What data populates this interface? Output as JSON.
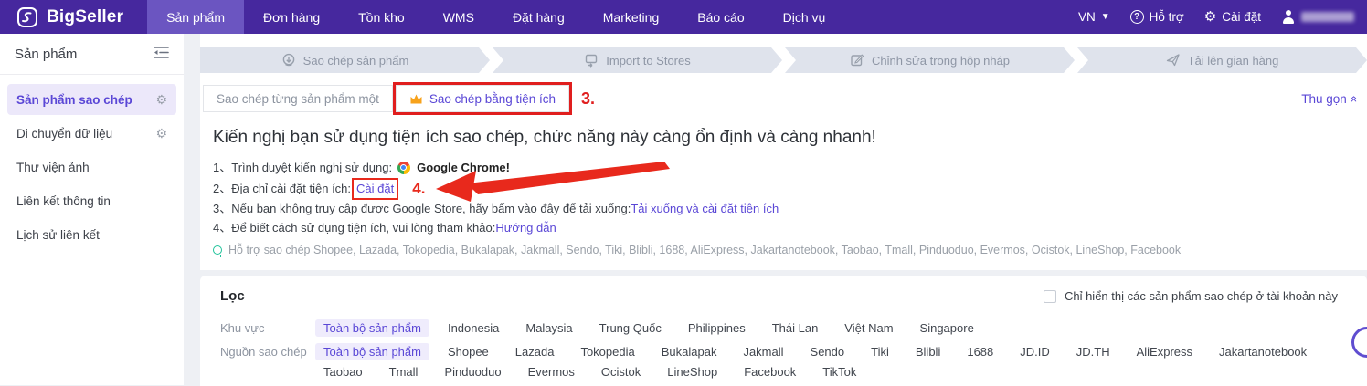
{
  "navbar": {
    "brand": "BigSeller",
    "items": [
      {
        "label": "Sản phẩm",
        "active": true
      },
      {
        "label": "Đơn hàng"
      },
      {
        "label": "Tồn kho"
      },
      {
        "label": "WMS"
      },
      {
        "label": "Đặt hàng"
      },
      {
        "label": "Marketing"
      },
      {
        "label": "Báo cáo"
      },
      {
        "label": "Dịch vụ"
      }
    ],
    "locale": "VN",
    "help_label": "Hỗ trợ",
    "settings_label": "Cài đặt"
  },
  "sidebar": {
    "title": "Sản phẩm",
    "items": [
      {
        "label": "Sản phẩm sao chép",
        "active": true,
        "gear": true
      },
      {
        "label": "Di chuyển dữ liệu",
        "gear": true
      },
      {
        "label": "Thư viện ảnh"
      },
      {
        "label": "Liên kết thông tin"
      },
      {
        "label": "Lịch sử liên kết"
      }
    ]
  },
  "steps": [
    {
      "label": "Sao chép sản phẩm"
    },
    {
      "label": "Import to Stores"
    },
    {
      "label": "Chỉnh sửa trong hộp nháp"
    },
    {
      "label": "Tải lên gian hàng"
    }
  ],
  "tabs": {
    "tab1": "Sao chép từng sản phẩm một",
    "tab2": "Sao chép bằng tiện ích",
    "collapse": "Thu gọn"
  },
  "annotations": {
    "tab_step": "3.",
    "install_step": "4."
  },
  "intro": {
    "heading": "Kiến nghị bạn sử dụng tiện ích sao chép, chức năng này càng ổn định và càng nhanh!",
    "line1_prefix": "1、Trình duyệt kiến nghị sử dụng:",
    "line1_bold": "Google Chrome!",
    "line2_prefix": "2、Địa chỉ cài đặt tiện ích:",
    "line2_link": "Cài đặt",
    "line3_prefix": "3、Nếu bạn không truy cập được Google Store, hãy bấm vào đây để tải xuống:",
    "line3_link": "Tải xuống và cài đặt tiện ích",
    "line4_prefix": "4、Để biết cách sử dụng tiện ích, vui lòng tham khảo:",
    "line4_link": "Hướng dẫn",
    "support": "Hỗ trợ sao chép Shopee, Lazada, Tokopedia, Bukalapak, Jakmall, Sendo, Tiki, Blibli, 1688, AliExpress, Jakartanotebook, Taobao, Tmall, Pinduoduo, Evermos, Ocistok, LineShop, Facebook"
  },
  "filter": {
    "title": "Lọc",
    "checkbox_label": "Chỉ hiển thị các sản phẩm sao chép ở tài khoản này",
    "region_label": "Khu vực",
    "region_options": [
      {
        "label": "Toàn bộ sản phẩm",
        "selected": true
      },
      {
        "label": "Indonesia"
      },
      {
        "label": "Malaysia"
      },
      {
        "label": "Trung Quốc"
      },
      {
        "label": "Philippines"
      },
      {
        "label": "Thái Lan"
      },
      {
        "label": "Việt Nam"
      },
      {
        "label": "Singapore"
      }
    ],
    "source_label": "Nguồn sao chép",
    "source_options": [
      {
        "label": "Toàn bộ sản phẩm",
        "selected": true
      },
      {
        "label": "Shopee"
      },
      {
        "label": "Lazada"
      },
      {
        "label": "Tokopedia"
      },
      {
        "label": "Bukalapak"
      },
      {
        "label": "Jakmall"
      },
      {
        "label": "Sendo"
      },
      {
        "label": "Tiki"
      },
      {
        "label": "Blibli"
      },
      {
        "label": "1688"
      },
      {
        "label": "JD.ID"
      },
      {
        "label": "JD.TH"
      },
      {
        "label": "AliExpress"
      },
      {
        "label": "Jakartanotebook"
      },
      {
        "label": "Taobao"
      },
      {
        "label": "Tmall"
      },
      {
        "label": "Pinduoduo"
      },
      {
        "label": "Evermos"
      },
      {
        "label": "Ocistok"
      },
      {
        "label": "LineShop"
      },
      {
        "label": "Facebook"
      },
      {
        "label": "TikTok"
      }
    ]
  },
  "colors": {
    "navbar": "#46289e",
    "accent": "#5a47d6",
    "annotation": "#e01e1e",
    "selected_bg": "#efecfc"
  }
}
